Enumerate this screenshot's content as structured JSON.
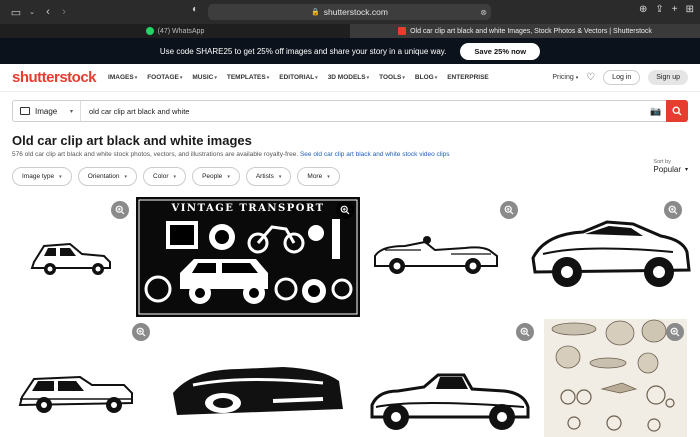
{
  "browser": {
    "url": "shutterstock.com",
    "tabs": [
      {
        "label": "(47) WhatsApp",
        "active": false
      },
      {
        "label": "Old car clip art black and white Images, Stock Photos & Vectors | Shutterstock",
        "active": true
      }
    ]
  },
  "promo": {
    "text": "Use code SHARE25 to get 25% off images and share your story in a unique way.",
    "button": "Save 25% now"
  },
  "header": {
    "logo": "shutterstock",
    "nav": [
      "IMAGES",
      "FOOTAGE",
      "MUSIC",
      "TEMPLATES",
      "EDITORIAL",
      "3D MODELS",
      "TOOLS",
      "BLOG",
      "ENTERPRISE"
    ],
    "pricing": "Pricing",
    "login": "Log in",
    "signup": "Sign up"
  },
  "search": {
    "type": "Image",
    "query": "old car clip art black and white"
  },
  "results": {
    "title": "Old car clip art black and white images",
    "subtitle": "576 old car clip art black and white stock photos, vectors, and illustrations are available royalty-free.",
    "link": "See old car clip art black and white stock video clips"
  },
  "filters": [
    "Image type",
    "Orientation",
    "Color",
    "People",
    "Artists",
    "More"
  ],
  "sort": {
    "label": "Sort by",
    "value": "Popular"
  },
  "tiles": {
    "vintage_title": "VINTAGE TRANSPORT"
  },
  "colors": {
    "brand": "#e63d2e",
    "promo_bg": "#0c121c",
    "link": "#1f5fbd"
  }
}
